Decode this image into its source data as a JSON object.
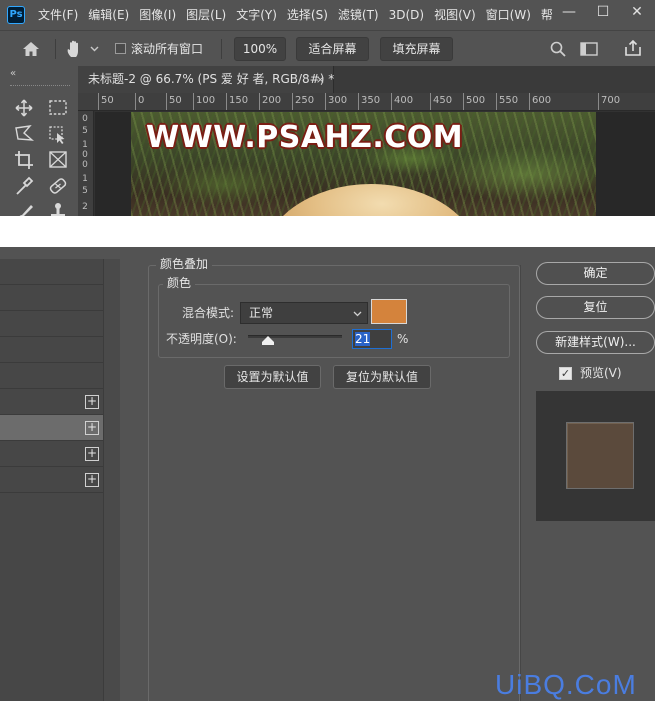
{
  "app": {
    "logo": "Ps",
    "menu": [
      "文件(F)",
      "编辑(E)",
      "图像(I)",
      "图层(L)",
      "文字(Y)",
      "选择(S)",
      "滤镜(T)",
      "3D(D)",
      "视图(V)",
      "窗口(W)",
      "帮"
    ],
    "window_buttons": {
      "minimize": "—",
      "maximize": "☐",
      "close": "✕"
    }
  },
  "options_bar": {
    "scroll_all_windows": "滚动所有窗口",
    "zoom": "100%",
    "fit_screen": "适合屏幕",
    "fill_screen": "填充屏幕"
  },
  "toolbar": {
    "collapse": "«"
  },
  "document": {
    "tab_title": "未标题-2 @ 66.7% (PS 爱 好 者, RGB/8#) *",
    "tab_close": "×",
    "ruler_h": [
      "50",
      "0",
      "50",
      "100",
      "150",
      "200",
      "250",
      "300",
      "350",
      "400",
      "450",
      "500",
      "550",
      "600",
      "700"
    ],
    "ruler_v": [
      "0",
      "5",
      "1",
      "0",
      "0",
      "1",
      "5",
      "2"
    ],
    "canvas_text": "WWW.PSAHZ.COM"
  },
  "dialog": {
    "section_title": "颜色叠加",
    "subsection_title": "颜色",
    "blend_mode_label": "混合模式:",
    "blend_mode_value": "正常",
    "overlay_color": "#d4833c",
    "opacity_label": "不透明度(O):",
    "opacity_value": "21",
    "opacity_fraction": 0.21,
    "opacity_unit": "%",
    "set_default": "设置为默认值",
    "reset_default": "复位为默认值",
    "ok": "确定",
    "reset": "复位",
    "new_style": "新建样式(W)...",
    "preview_label": "预览(V)",
    "preview_checked": true,
    "style_rows_plus": [
      "+",
      "+",
      "+",
      "+"
    ]
  },
  "site_watermark": "UiBQ.CoM"
}
